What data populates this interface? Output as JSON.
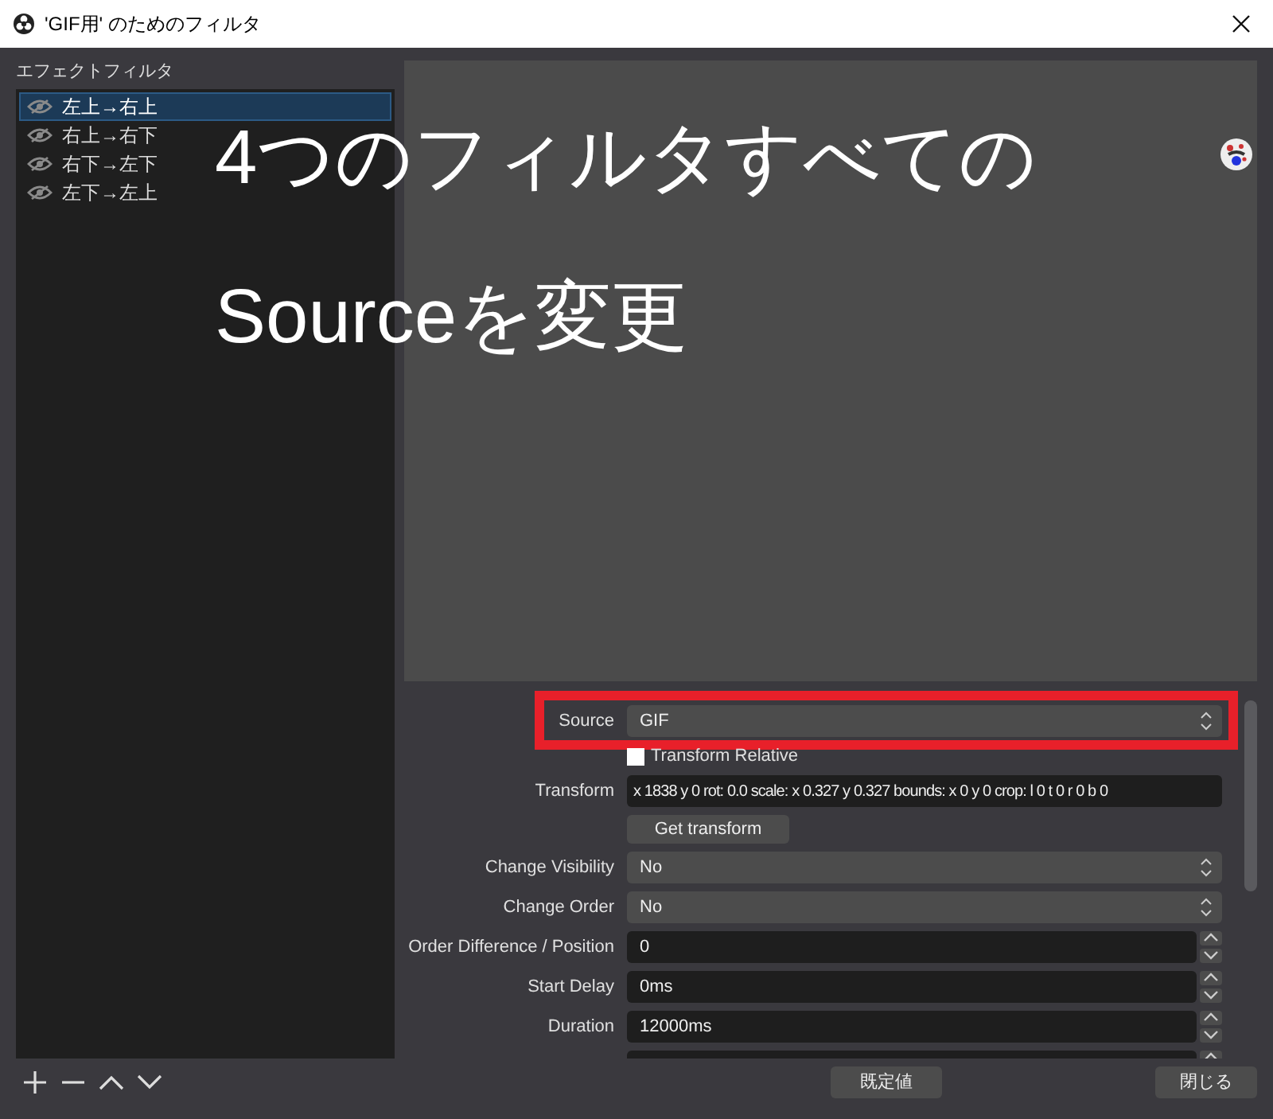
{
  "window": {
    "title": "'GIF用' のためのフィルタ"
  },
  "filters": {
    "heading": "エフェクトフィルタ",
    "items": [
      {
        "label": "左上→右上",
        "selected": true
      },
      {
        "label": "右上→右下",
        "selected": false
      },
      {
        "label": "右下→左下",
        "selected": false
      },
      {
        "label": "左下→左上",
        "selected": false
      }
    ]
  },
  "overlay_text": [
    "4つのフィルタすべての",
    "Sourceを変更"
  ],
  "properties": [
    {
      "kind": "select",
      "label": "Source",
      "value": "GIF",
      "highlighted": true
    },
    {
      "kind": "checkbox",
      "label": "Transform Relative",
      "checked": false
    },
    {
      "kind": "text",
      "label": "Transform",
      "value": "x 1838 y 0 rot: 0.0 scale: x 0.327 y 0.327 bounds: x 0 y 0 crop: l 0 t 0 r 0 b 0"
    },
    {
      "kind": "button",
      "label": "Get transform"
    },
    {
      "kind": "select",
      "label": "Change Visibility",
      "value": "No"
    },
    {
      "kind": "select",
      "label": "Change Order",
      "value": "No"
    },
    {
      "kind": "spin",
      "label": "Order Difference / Position",
      "value": "0"
    },
    {
      "kind": "spin",
      "label": "Start Delay",
      "value": "0ms"
    },
    {
      "kind": "spin",
      "label": "Duration",
      "value": "12000ms"
    },
    {
      "kind": "spin"
    }
  ],
  "footer": {
    "defaults_button": "既定値",
    "close_button": "閉じる"
  }
}
